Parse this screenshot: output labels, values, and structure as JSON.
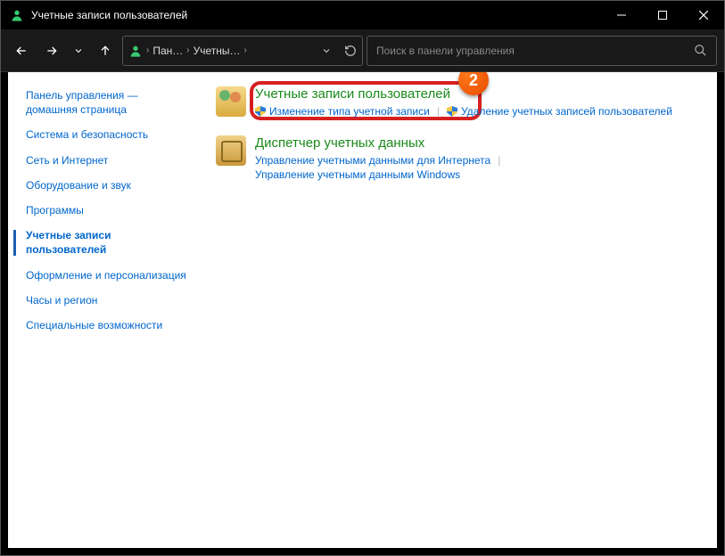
{
  "window": {
    "title": "Учетные записи пользователей"
  },
  "breadcrumbs": {
    "b1": "Пан…",
    "b2": "Учетны…"
  },
  "search": {
    "placeholder": "Поиск в панели управления"
  },
  "sidebar": {
    "items": [
      "Панель управления — домашняя страница",
      "Система и безопасность",
      "Сеть и Интернет",
      "Оборудование и звук",
      "Программы",
      "Учетные записи пользователей",
      "Оформление и персонализация",
      "Часы и регион",
      "Специальные возможности"
    ],
    "active_index": 5
  },
  "main": {
    "cat_accounts": {
      "title": "Учетные записи пользователей",
      "sub1": "Изменение типа учетной записи",
      "sub2": "Удаление учетных записей пользователей"
    },
    "cat_cred": {
      "title": "Диспетчер учетных данных",
      "sub1": "Управление учетными данными для Интернета",
      "sub2": "Управление учетными данными Windows"
    }
  },
  "annotation": {
    "badge": "2"
  }
}
